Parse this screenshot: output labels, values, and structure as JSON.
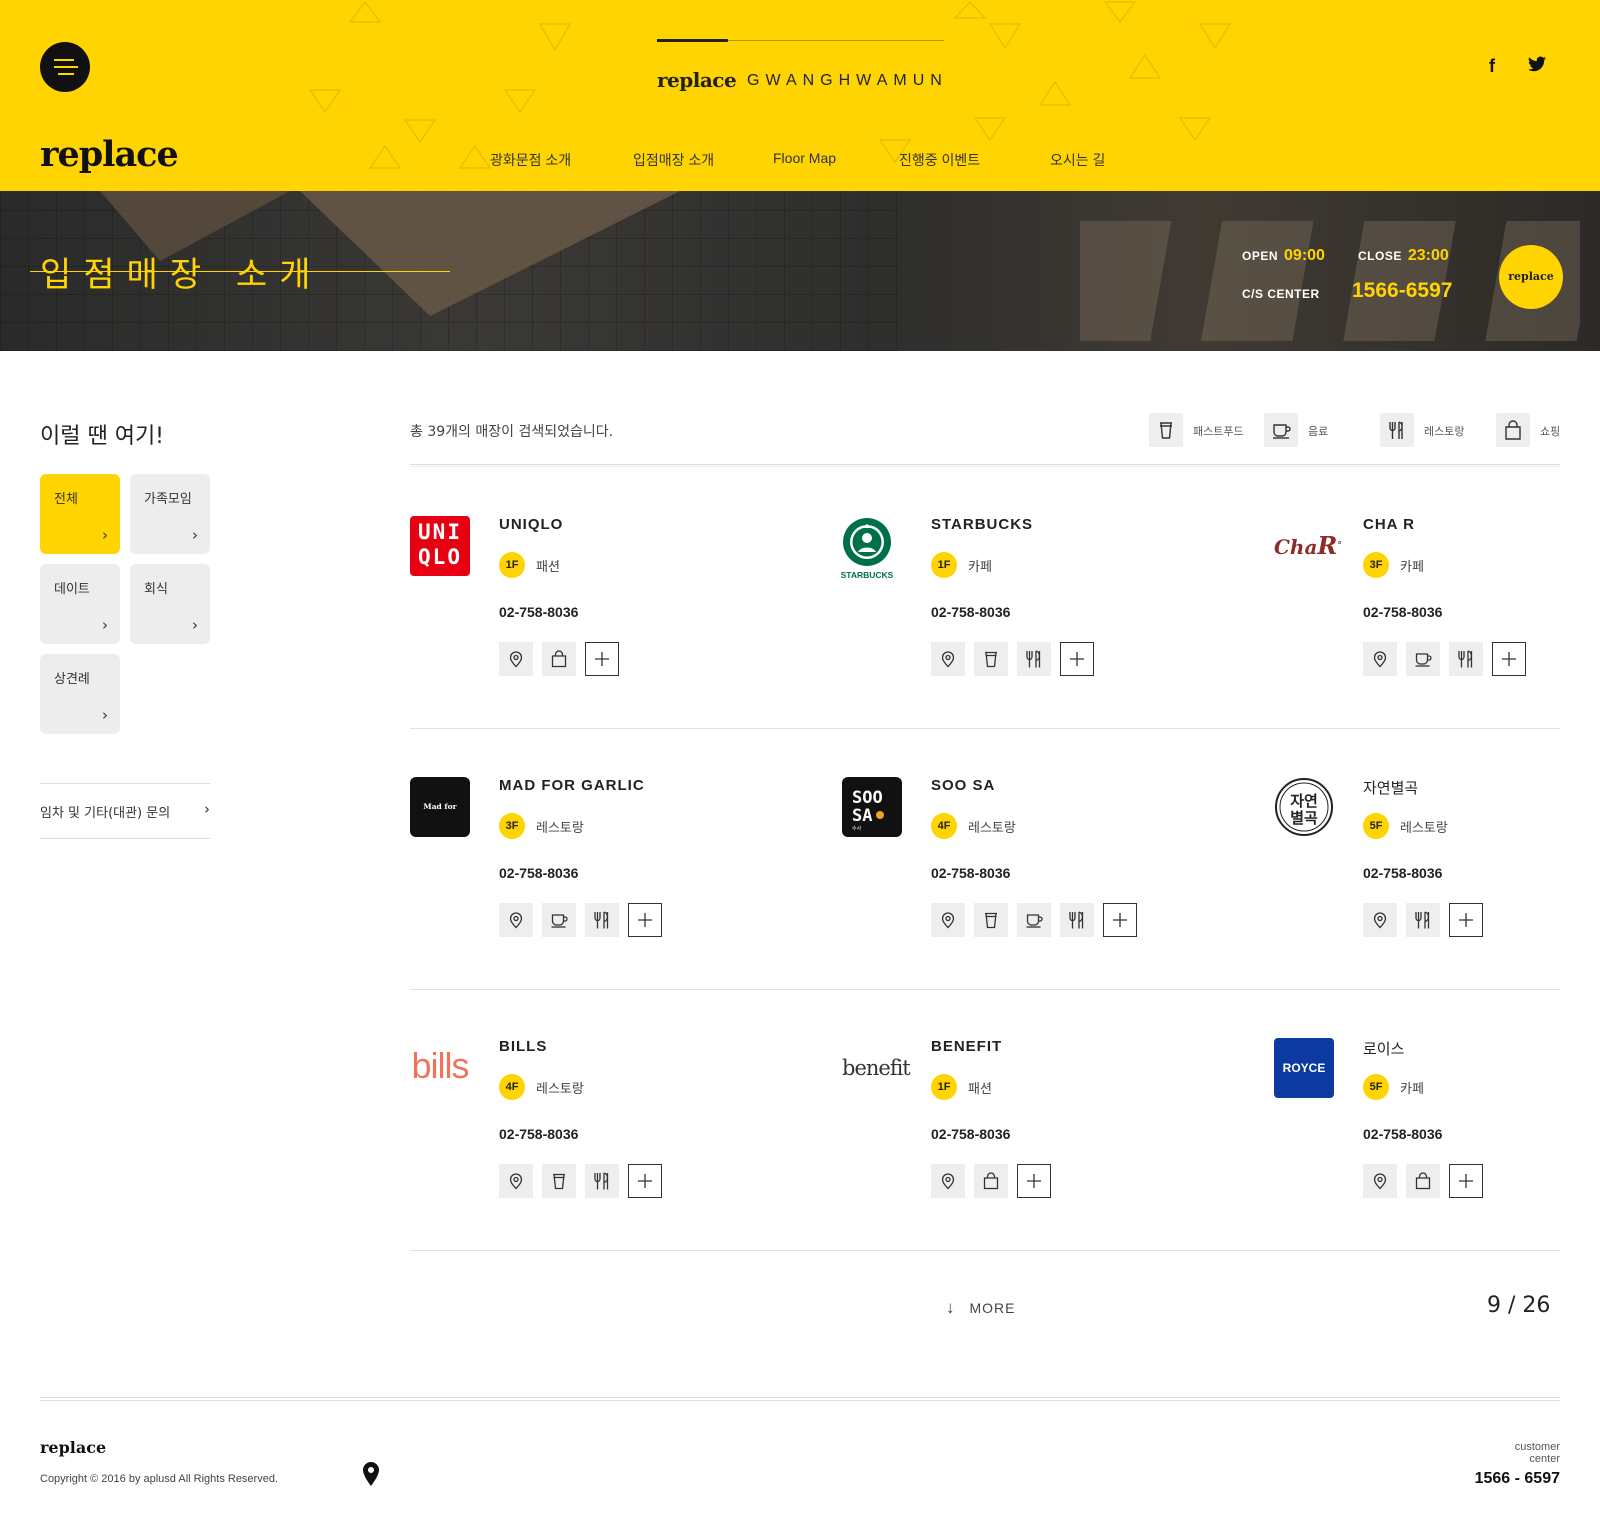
{
  "header": {
    "branch_brand": "replace",
    "branch_location": "GWANGHWAMUN",
    "logo": "replace",
    "nav": [
      "광화문점 소개",
      "입점매장 소개",
      "Floor Map",
      "진행중 이벤트",
      "오시는 길"
    ],
    "social": {
      "facebook": "f",
      "twitter": "twitter-icon"
    }
  },
  "hero": {
    "title": "입점매장 소개",
    "open_label": "OPEN",
    "open_time": "09:00",
    "close_label": "CLOSE",
    "close_time": "23:00",
    "cs_label": "C/S CENTER",
    "cs_phone": "1566-6597",
    "badge": "replace"
  },
  "sidebar": {
    "title": "이럴 땐 여기!",
    "tiles": [
      {
        "label": "전체",
        "arrow": "›",
        "active": true
      },
      {
        "label": "가족모임",
        "arrow": "›",
        "active": false
      },
      {
        "label": "데이트",
        "arrow": "›",
        "active": false
      },
      {
        "label": "회식",
        "arrow": "›",
        "active": false
      },
      {
        "label": "상견례",
        "arrow": "›",
        "active": false
      }
    ],
    "link": {
      "label": "임차 및 기타(대관) 문의",
      "arrow": "›"
    }
  },
  "main": {
    "result_count": "총 39개의 매장이 검색되었습니다.",
    "filters": [
      {
        "label": "패스트푸드",
        "icon": "cup-icon"
      },
      {
        "label": "음료",
        "icon": "coffee-icon"
      },
      {
        "label": "레스토랑",
        "icon": "utensils-icon"
      },
      {
        "label": "쇼핑",
        "icon": "bag-icon"
      }
    ],
    "stores": [
      {
        "name": "UNIQLO",
        "logo_text": "UNI QLO",
        "floor": "1F",
        "category": "패션",
        "phone": "02-758-8036",
        "icons": [
          "pin",
          "bag"
        ]
      },
      {
        "name": "STARBUCKS",
        "logo_text": "STARBUCKS",
        "floor": "1F",
        "category": "카페",
        "phone": "02-758-8036",
        "icons": [
          "pin",
          "cup",
          "utensils"
        ]
      },
      {
        "name": "CHA R",
        "logo_text": "ChaR",
        "floor": "3F",
        "category": "카페",
        "phone": "02-758-8036",
        "icons": [
          "pin",
          "coffee",
          "utensils"
        ]
      },
      {
        "name": "MAD FOR GARLIC",
        "logo_text": "Mad for Garlic",
        "floor": "3F",
        "category": "레스토랑",
        "phone": "02-758-8036",
        "icons": [
          "pin",
          "coffee",
          "utensils"
        ]
      },
      {
        "name": "SOO SA",
        "logo_text": "SOO SA",
        "floor": "4F",
        "category": "레스토랑",
        "phone": "02-758-8036",
        "icons": [
          "pin",
          "cup",
          "coffee",
          "utensils"
        ]
      },
      {
        "name": "자연별곡",
        "logo_text": "자연별곡",
        "floor": "5F",
        "category": "레스토랑",
        "phone": "02-758-8036",
        "icons": [
          "pin",
          "utensils"
        ]
      },
      {
        "name": "BILLS",
        "logo_text": "bills",
        "floor": "4F",
        "category": "레스토랑",
        "phone": "02-758-8036",
        "icons": [
          "pin",
          "cup",
          "utensils"
        ]
      },
      {
        "name": "BENEFIT",
        "logo_text": "benefit",
        "floor": "1F",
        "category": "패션",
        "phone": "02-758-8036",
        "icons": [
          "pin",
          "bag"
        ]
      },
      {
        "name": "로이스",
        "logo_text": "ROYCE",
        "floor": "5F",
        "category": "카페",
        "phone": "02-758-8036",
        "icons": [
          "pin",
          "bag"
        ]
      }
    ],
    "more_label": "MORE",
    "pager": "9 / 26"
  },
  "footer": {
    "logo": "replace",
    "copyright": "Copyright © 2016 by aplusd  All Rights Reserved.",
    "cc_line1": "customer",
    "cc_line2": "center",
    "phone": "1566 - 6597"
  },
  "colors": {
    "brand_yellow": "#ffd400",
    "dark": "#111111"
  }
}
